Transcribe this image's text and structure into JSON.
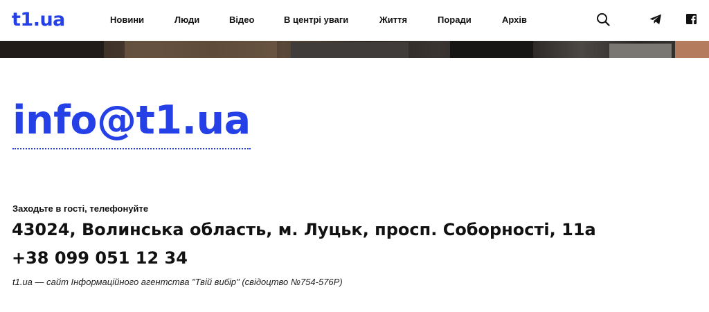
{
  "header": {
    "logo": "t1.ua",
    "nav": [
      {
        "label": "Новини"
      },
      {
        "label": "Люди"
      },
      {
        "label": "Відео"
      },
      {
        "label": "В центрі уваги"
      },
      {
        "label": "Життя"
      },
      {
        "label": "Поради"
      },
      {
        "label": "Архів"
      }
    ],
    "icons": [
      "search-icon",
      "telegram-icon",
      "facebook-icon"
    ]
  },
  "main": {
    "email": "info@t1.ua",
    "contact_label": "Заходьте в гості, телефонуйте",
    "address": "43024, Волинська область, м. Луцьк, просп. Соборності, 11а",
    "phone": "+38 099 051 12 34",
    "note": "t1.ua — сайт Інформаційного агентства \"Твій вибір\" (свідоцтво №754-576Р)"
  },
  "colors": {
    "brand": "#2440e6",
    "text": "#111111",
    "background": "#ffffff"
  }
}
